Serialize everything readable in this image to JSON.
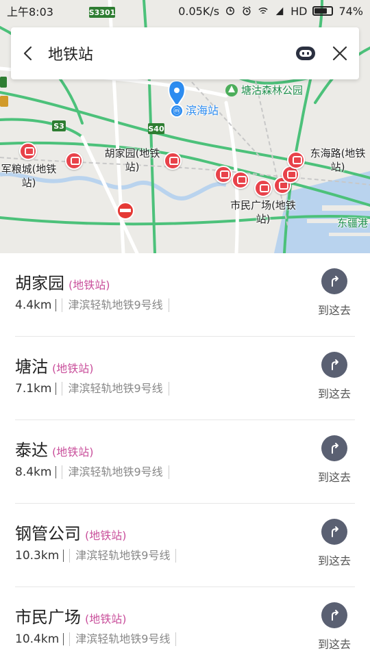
{
  "status_bar": {
    "time": "上午8:03",
    "speed": "0.05K/s",
    "network": "HD",
    "battery": "74%",
    "battery_level": 0.74
  },
  "search": {
    "query": "地铁站"
  },
  "map": {
    "shields": [
      "S3301",
      "S3",
      "S40"
    ],
    "stations": [
      {
        "label": "滨海站"
      },
      {
        "label": "塘沽森林公园"
      },
      {
        "label": "胡家园(地铁站)"
      },
      {
        "label": "东海路(地铁站)"
      },
      {
        "label": "军粮城(地铁站)"
      },
      {
        "label": "市民广场(地铁站)"
      },
      {
        "label": "东疆港"
      }
    ]
  },
  "results": [
    {
      "name": "胡家园",
      "tag": "(地铁站)",
      "distance": "4.4km",
      "line": "津滨轻轨地铁9号线",
      "go_label": "到这去"
    },
    {
      "name": "塘沽",
      "tag": "(地铁站)",
      "distance": "7.1km",
      "line": "津滨轻轨地铁9号线",
      "go_label": "到这去"
    },
    {
      "name": "泰达",
      "tag": "(地铁站)",
      "distance": "8.4km",
      "line": "津滨轻轨地铁9号线",
      "go_label": "到这去"
    },
    {
      "name": "钢管公司",
      "tag": "(地铁站)",
      "distance": "10.3km",
      "line": "津滨轻轨地铁9号线",
      "go_label": "到这去"
    },
    {
      "name": "市民广场",
      "tag": "(地铁站)",
      "distance": "10.4km",
      "line": "津滨轻轨地铁9号线",
      "go_label": "到这去"
    }
  ]
}
